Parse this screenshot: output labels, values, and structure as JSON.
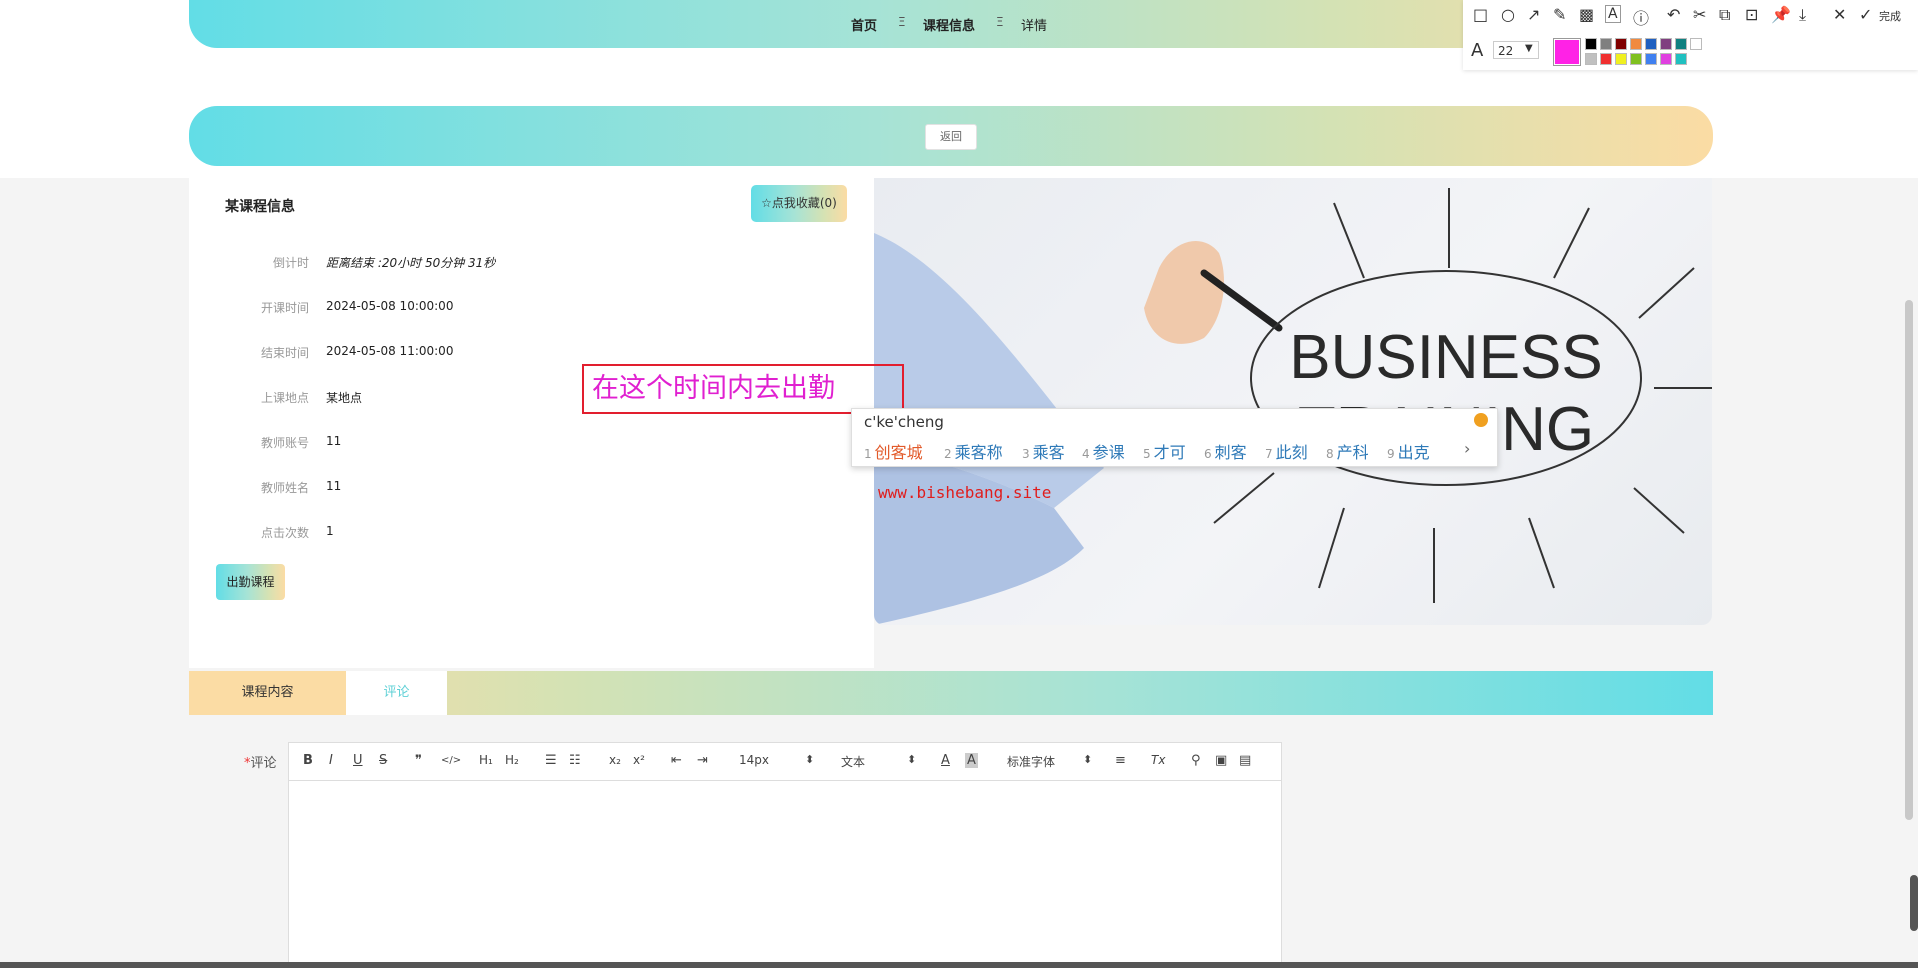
{
  "breadcrumb": {
    "home": "首页",
    "sep": "Ξ",
    "course_info": "课程信息",
    "detail": "详情"
  },
  "back_label": "返回",
  "course": {
    "title": "某课程信息",
    "favorite_label": "☆点我收藏(0)",
    "fields": [
      {
        "label": "倒计时",
        "value": "距离结束 :20小时 50分钟 31秒"
      },
      {
        "label": "开课时间",
        "value": "2024-05-08 10:00:00"
      },
      {
        "label": "结束时间",
        "value": "2024-05-08 11:00:00"
      },
      {
        "label": "上课地点",
        "value": "某地点"
      },
      {
        "label": "教师账号",
        "value": "11"
      },
      {
        "label": "教师姓名",
        "value": "11"
      },
      {
        "label": "点击次数",
        "value": "1"
      }
    ],
    "attend_label": "出勤课程"
  },
  "image": {
    "text_line1": "BUSINESS",
    "text_line2": "TRAINING"
  },
  "annotation_text": "在这个时间内去出勤",
  "ime": {
    "input": "c'ke'cheng",
    "candidates": [
      {
        "n": "1",
        "t": "创客城"
      },
      {
        "n": "2",
        "t": "乘客称"
      },
      {
        "n": "3",
        "t": "乘客"
      },
      {
        "n": "4",
        "t": "参课"
      },
      {
        "n": "5",
        "t": "才可"
      },
      {
        "n": "6",
        "t": "刺客"
      },
      {
        "n": "7",
        "t": "此刻"
      },
      {
        "n": "8",
        "t": "产科"
      },
      {
        "n": "9",
        "t": "出克"
      }
    ],
    "more": "›"
  },
  "watermark": "www.bishebang.site",
  "tabs": {
    "content": "课程内容",
    "comment": "评论"
  },
  "comment": {
    "required": "*",
    "label": "评论"
  },
  "editor_toolbar": {
    "bold": "B",
    "italic": "I",
    "underline": "U",
    "strike": "S",
    "quote": "❞",
    "code": "</>",
    "h1": "H₁",
    "h2": "H₂",
    "ol": "☰",
    "ul": "☷",
    "sub": "x₂",
    "sup": "x²",
    "outdent": "⇤",
    "indent": "⇥",
    "size": "14px",
    "header": "文本",
    "font": "标准字体",
    "color": "A",
    "background": "A",
    "align": "≡",
    "clean": "Tx",
    "link": "⚲",
    "image": "▣",
    "video": "▤",
    "caret": "⬍"
  },
  "screenshot_tools": {
    "font_size": "22",
    "done_label": "完成",
    "active_color": "#ff22e6",
    "palette": [
      "#000000",
      "#808080",
      "#800000",
      "#f08a40",
      "#2060c0",
      "#804080",
      "#108080",
      "#ffffff",
      "#c0c0c0",
      "#f03030",
      "#f0f020",
      "#80c020",
      "#4080f0",
      "#e040e0",
      "#20c0c0"
    ]
  }
}
